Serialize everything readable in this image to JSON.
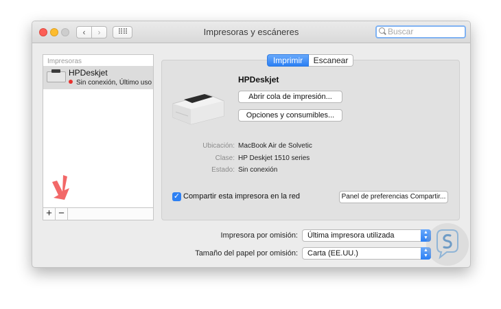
{
  "window": {
    "title": "Impresoras y escáneres"
  },
  "toolbar": {
    "back": "‹",
    "forward": "›",
    "grid": "⠿⠿"
  },
  "search": {
    "placeholder": "Buscar"
  },
  "sidebar": {
    "header": "Impresoras",
    "items": [
      {
        "name": "HPDeskjet",
        "status": "Sin conexión, Último uso"
      }
    ],
    "add_label": "+",
    "remove_label": "−"
  },
  "tabs": [
    {
      "label": "Imprimir",
      "selected": true
    },
    {
      "label": "Escanear",
      "selected": false
    }
  ],
  "printer": {
    "name": "HPDeskjet",
    "open_queue": "Abrir cola de impresión...",
    "options": "Opciones y consumibles...",
    "details": [
      {
        "label": "Ubicación:",
        "value": "MacBook Air de Solvetic"
      },
      {
        "label": "Clase:",
        "value": "HP Deskjet 1510 series"
      },
      {
        "label": "Estado:",
        "value": "Sin conexión"
      }
    ],
    "share_label": "Compartir esta impresora en la red",
    "share_checked": true,
    "share_prefs": "Panel de preferencias Compartir..."
  },
  "defaults": {
    "printer_label": "Impresora por omisión:",
    "printer_value": "Última impresora utilizada",
    "paper_label": "Tamaño del papel por omisión:",
    "paper_value": "Carta (EE.UU.)"
  },
  "colors": {
    "accent": "#2a7ff4",
    "status_offline": "#e8322e",
    "annotation_arrow": "#f26868"
  }
}
